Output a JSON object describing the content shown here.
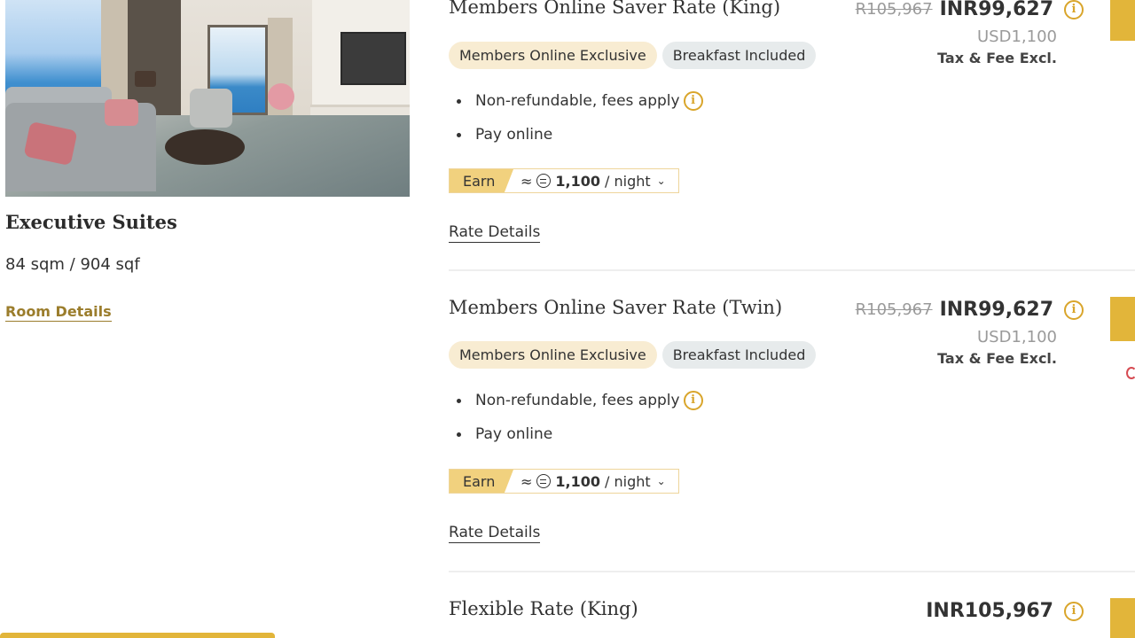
{
  "room": {
    "name": "Executive Suites",
    "size": "84 sqm / 904 sqf",
    "details_link": "Room Details"
  },
  "rates": [
    {
      "name": "Members Online Saver Rate (King)",
      "tags": [
        "Members Online Exclusive",
        "Breakfast Included"
      ],
      "conditions": [
        "Non-refundable, fees apply",
        "Pay online"
      ],
      "earn_label": "Earn",
      "earn_prefix": "≈",
      "earn_points": "1,100",
      "earn_suffix": "/ night",
      "details_link": "Rate Details",
      "old_price": "R105,967",
      "price": "INR99,627",
      "usd_price": "USD1,100",
      "tax_note": "Tax & Fee Excl."
    },
    {
      "name": "Members Online Saver Rate (Twin)",
      "tags": [
        "Members Online Exclusive",
        "Breakfast Included"
      ],
      "conditions": [
        "Non-refundable, fees apply",
        "Pay online"
      ],
      "earn_label": "Earn",
      "earn_prefix": "≈",
      "earn_points": "1,100",
      "earn_suffix": "/ night",
      "details_link": "Rate Details",
      "old_price": "R105,967",
      "price": "INR99,627",
      "usd_price": "USD1,100",
      "tax_note": "Tax & Fee Excl."
    },
    {
      "name": "Flexible Rate (King)",
      "price": "INR105,967"
    }
  ],
  "icons": {
    "info": "info-icon",
    "points": "points-icon",
    "chevron": "chevron-down-icon"
  },
  "colors": {
    "accent_gold": "#e2b53a",
    "link_gold": "#9b7d2c",
    "exclusive_tag_bg": "#f8ecd2",
    "breakfast_tag_bg": "#e7ebec",
    "earn_bg": "#f1d17e"
  }
}
